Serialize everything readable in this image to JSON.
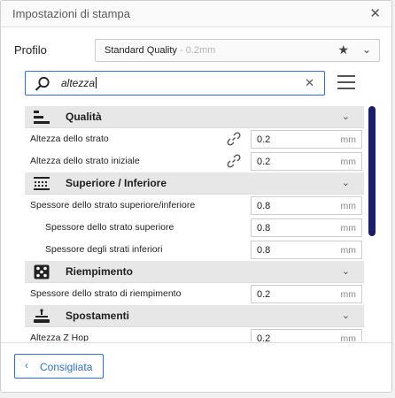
{
  "window": {
    "title": "Impostazioni di stampa",
    "close_icon": "close-icon"
  },
  "profile": {
    "label": "Profilo",
    "name": "Standard Quality",
    "sub": " - 0.2mm",
    "star_icon": "star-icon",
    "chevron_icon": "chevron-down-icon"
  },
  "search": {
    "value": "altezza",
    "clear_icon": "clear-icon"
  },
  "colors": {
    "accent": "#2a6fdb",
    "scrollbar": "#1a1f6b",
    "category_bg": "#e7e7e7"
  },
  "categories": [
    {
      "label": "Qualità",
      "icon": "quality-icon",
      "settings": [
        {
          "label": "Altezza dello strato",
          "value": "0.2",
          "unit": "mm",
          "linked": true
        },
        {
          "label": "Altezza dello strato iniziale",
          "value": "0.2",
          "unit": "mm",
          "linked": true
        }
      ]
    },
    {
      "label": "Superiore / Inferiore",
      "icon": "top-bottom-icon",
      "settings": [
        {
          "label": "Spessore dello strato superiore/inferiore",
          "value": "0.8",
          "unit": "mm"
        },
        {
          "label": "Spessore dello strato superiore",
          "value": "0.8",
          "unit": "mm",
          "indent": true
        },
        {
          "label": "Spessore degli strati inferiori",
          "value": "0.8",
          "unit": "mm",
          "indent": true
        }
      ]
    },
    {
      "label": "Riempimento",
      "icon": "infill-icon",
      "settings": [
        {
          "label": "Spessore dello strato di riempimento",
          "value": "0.2",
          "unit": "mm"
        }
      ]
    },
    {
      "label": "Spostamenti",
      "icon": "travel-icon",
      "settings": [
        {
          "label": "Altezza Z Hop",
          "value": "0.2",
          "unit": "mm"
        }
      ]
    }
  ],
  "footer": {
    "recommended_label": "Consigliata",
    "arrow_icon": "chevron-left-icon"
  }
}
